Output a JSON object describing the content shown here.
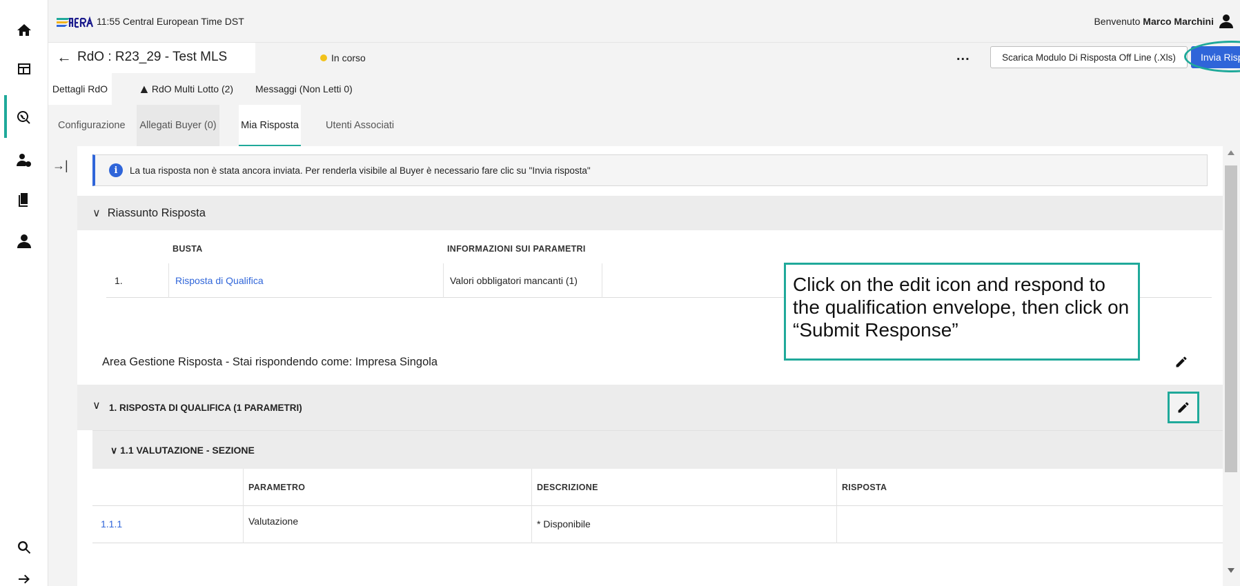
{
  "header": {
    "clock": "11:55 Central European Time DST",
    "welcome_prefix": "Benvenuto",
    "user_name": "Marco Marchini"
  },
  "title_bar": {
    "title": "RdO : R23_29 - Test MLS",
    "status": "In corso",
    "status_color": "#f2c21b",
    "more": "...",
    "download_button": "Scarica Modulo Di Risposta Off Line (.Xls)",
    "send_button": "Invia Risposta"
  },
  "tabs_primary": [
    {
      "label": "Dettagli RdO"
    },
    {
      "label": "RdO Multi Lotto (2)"
    },
    {
      "label": "Messaggi (Non Letti 0)"
    }
  ],
  "tabs_secondary": [
    {
      "label": "Configurazione"
    },
    {
      "label": "Allegati Buyer (0)"
    },
    {
      "label": "Mia Risposta"
    },
    {
      "label": "Utenti Associati"
    }
  ],
  "info_message": "La tua risposta non è stata ancora inviata. Per renderla visibile al Buyer è necessario fare clic su \"Invia risposta\"",
  "summary": {
    "title": "Riassunto Risposta",
    "columns": [
      "BUSTA",
      "INFORMAZIONI SUI PARAMETRI"
    ],
    "rows": [
      {
        "index": "1.",
        "busta": "Risposta di Qualifica",
        "info": "Valori obbligatori mancanti (1)"
      }
    ]
  },
  "area_title": "Area Gestione Risposta - Stai rispondendo come: Impresa Singola",
  "qualifica_title": "1. RISPOSTA DI QUALIFICA (1 PARAMETRI)",
  "section_title": "1.1  VALUTAZIONE - SEZIONE",
  "parameters": {
    "columns": [
      "PARAMETRO",
      "DESCRIZIONE",
      "RISPOSTA"
    ],
    "rows": [
      {
        "id": "1.1.1",
        "parametro": "Valutazione",
        "descrizione": "Disponibile",
        "risposta": ""
      }
    ]
  },
  "callout": "Click on the edit icon and respond to the qualification envelope, then click on “Submit Response”",
  "colors": {
    "accent": "#1fa99a",
    "primary": "#2f65d9"
  }
}
